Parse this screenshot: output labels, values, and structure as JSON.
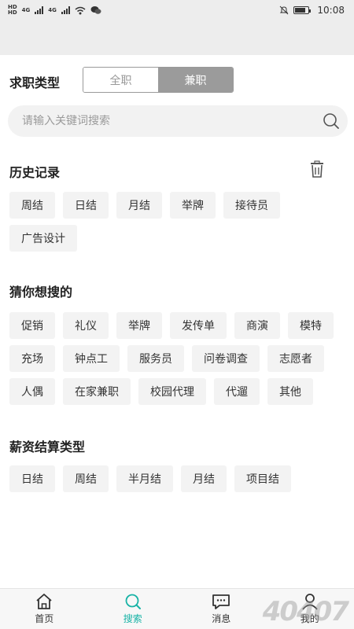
{
  "status_bar": {
    "time": "10:08",
    "carrier_1": "HD",
    "carrier_2": "HD",
    "net_1": "4G",
    "net_2": "4G"
  },
  "job_type": {
    "label": "求职类型",
    "options": [
      "全职",
      "兼职"
    ],
    "selected": "兼职"
  },
  "search": {
    "placeholder": "请输入关键词搜索"
  },
  "history": {
    "title": "历史记录",
    "tags": [
      "周结",
      "日结",
      "月结",
      "举牌",
      "接待员",
      "广告设计"
    ]
  },
  "guess": {
    "title": "猜你想搜的",
    "tags": [
      "促销",
      "礼仪",
      "举牌",
      "发传单",
      "商演",
      "模特",
      "充场",
      "钟点工",
      "服务员",
      "问卷调查",
      "志愿者",
      "人偶",
      "在家兼职",
      "校园代理",
      "代遛",
      "其他"
    ]
  },
  "salary": {
    "title": "薪资结算类型",
    "tags": [
      "日结",
      "周结",
      "半月结",
      "月结",
      "项目结"
    ]
  },
  "tabbar": {
    "tabs": [
      {
        "label": "首页",
        "icon": "home-icon"
      },
      {
        "label": "搜索",
        "icon": "search-icon"
      },
      {
        "label": "消息",
        "icon": "message-icon"
      },
      {
        "label": "我的",
        "icon": "user-icon"
      }
    ],
    "active": "搜索",
    "active_color": "#18b3a6"
  },
  "watermark": "40407"
}
